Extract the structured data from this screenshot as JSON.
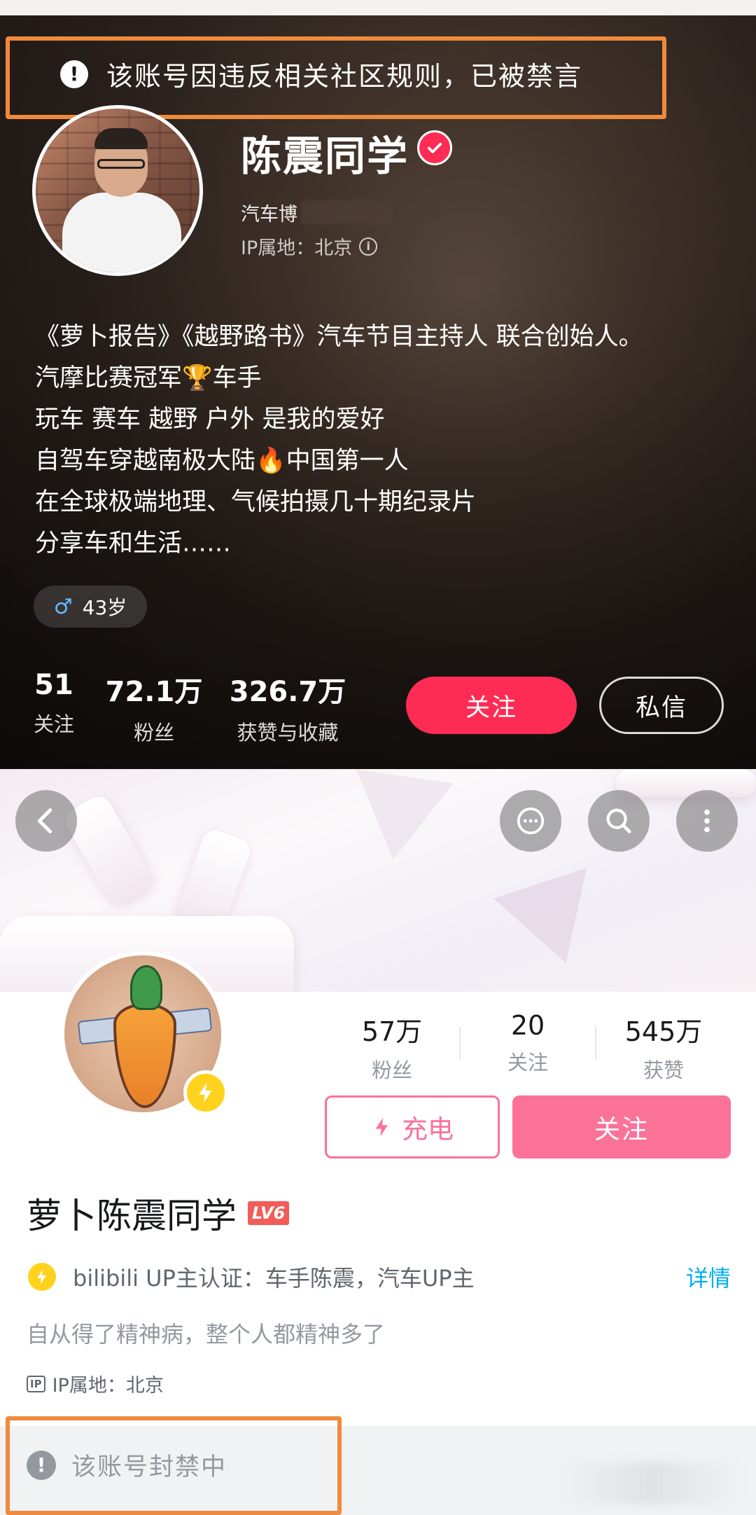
{
  "top_profile": {
    "ban_notice": "该账号因违反相关社区规则，已被禁言",
    "name": "陈震同学",
    "role": "汽车博",
    "ip_location": "IP属地：北京",
    "bio": [
      "《萝卜报告》《越野路书》汽车节目主持人 联合创始人。",
      "汽摩比赛冠军🏆车手",
      "玩车 赛车 越野 户外 是我的爱好",
      "自驾车穿越南极大陆🔥中国第一人",
      "在全球极端地理、气候拍摄几十期纪录片",
      "分享车和生活……"
    ],
    "age": "43岁",
    "stats": [
      {
        "value": "51",
        "label": "关注"
      },
      {
        "value": "72.1万",
        "label": "粉丝"
      },
      {
        "value": "326.7万",
        "label": "获赞与收藏"
      }
    ],
    "follow_button": "关注",
    "message_button": "私信"
  },
  "bottom_profile": {
    "stats": [
      {
        "value": "57万",
        "label": "粉丝"
      },
      {
        "value": "20",
        "label": "关注"
      },
      {
        "value": "545万",
        "label": "获赞"
      }
    ],
    "charge_button": "充电",
    "follow_button": "关注",
    "name": "萝卜陈震同学",
    "level_badge": "LV6",
    "certification": "bilibili UP主认证：车手陈震，汽车UP主",
    "details_link": "详情",
    "signature": "自从得了精神病，整个人都精神多了",
    "ip_tag": "IP",
    "ip_location": "IP属地：北京",
    "ban_notice": "该账号封禁中"
  },
  "colors": {
    "xhs_red": "#fe2c55",
    "bili_pink": "#fb7299",
    "bili_blue": "#00aeec",
    "highlight_frame": "#f08a3c",
    "level_red": "#f25d59",
    "charge_yellow": "#ffd21e"
  },
  "icons": [
    "alert-icon",
    "verified-icon",
    "info-icon",
    "male-icon",
    "back-icon",
    "chat-icon",
    "search-icon",
    "more-icon",
    "lightning-icon"
  ]
}
